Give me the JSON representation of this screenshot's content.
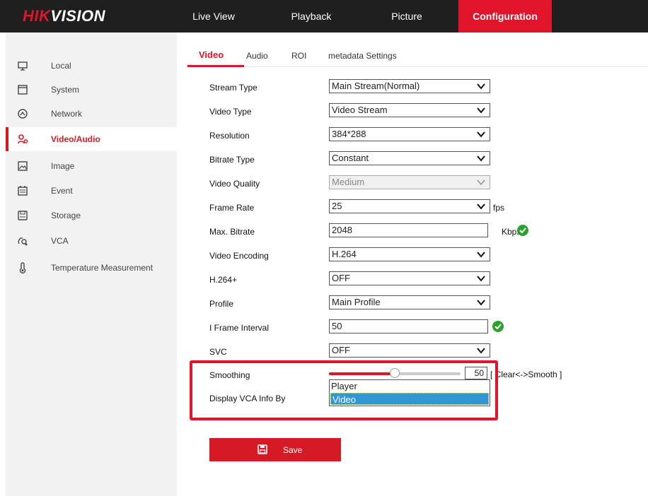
{
  "brand": {
    "part1": "HIK",
    "part2": "VISION"
  },
  "nav": [
    {
      "label": "Live View"
    },
    {
      "label": "Playback"
    },
    {
      "label": "Picture"
    },
    {
      "label": "Configuration"
    }
  ],
  "sidebar": {
    "items": [
      {
        "label": "Local",
        "icon": "monitor-icon"
      },
      {
        "label": "System",
        "icon": "system-icon"
      },
      {
        "label": "Network",
        "icon": "network-icon"
      },
      {
        "label": "Video/Audio",
        "icon": "video-audio-icon",
        "active": true
      },
      {
        "label": "Image",
        "icon": "image-icon"
      },
      {
        "label": "Event",
        "icon": "event-icon"
      },
      {
        "label": "Storage",
        "icon": "storage-icon"
      },
      {
        "label": "VCA",
        "icon": "vca-icon"
      },
      {
        "label": "Temperature Measurement",
        "icon": "thermometer-icon"
      }
    ]
  },
  "tabs": [
    {
      "label": "Video"
    },
    {
      "label": "Audio"
    },
    {
      "label": "ROI"
    },
    {
      "label": "metadata Settings"
    }
  ],
  "form": {
    "stream_type": {
      "label": "Stream Type",
      "value": "Main Stream(Normal)"
    },
    "video_type": {
      "label": "Video Type",
      "value": "Video Stream"
    },
    "resolution": {
      "label": "Resolution",
      "value": "384*288"
    },
    "bitrate_type": {
      "label": "Bitrate Type",
      "value": "Constant"
    },
    "video_quality": {
      "label": "Video Quality",
      "value": "Medium"
    },
    "frame_rate": {
      "label": "Frame Rate",
      "value": "25",
      "unit": "fps"
    },
    "max_bitrate": {
      "label": "Max. Bitrate",
      "value": "2048",
      "unit": "Kbps"
    },
    "video_encoding": {
      "label": "Video Encoding",
      "value": "H.264"
    },
    "h264plus": {
      "label": "H.264+",
      "value": "OFF"
    },
    "profile": {
      "label": "Profile",
      "value": "Main Profile"
    },
    "i_frame_interval": {
      "label": "I Frame Interval",
      "value": "50"
    },
    "svc": {
      "label": "SVC",
      "value": "OFF"
    },
    "smoothing": {
      "label": "Smoothing",
      "value": "50",
      "level": 0.5,
      "hint": "[ Clear<->Smooth ]"
    },
    "display_vca": {
      "label": "Display VCA Info By",
      "options": [
        "Player",
        "Video"
      ],
      "selected": "Video"
    }
  },
  "save": {
    "label": "Save"
  },
  "colors": {
    "accent": "#d51a25",
    "topbar": "#1f1f1f",
    "ok": "#2ca02c",
    "selected": "#3296d6"
  }
}
